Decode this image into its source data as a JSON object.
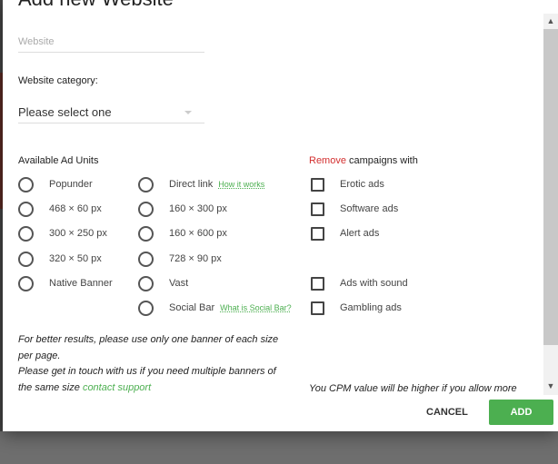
{
  "dialog": {
    "title": "Add new Website",
    "website_placeholder": "Website",
    "category_label": "Website category:",
    "category_value": "Please select one",
    "ad_units_heading": "Available Ad Units",
    "remove_word": "Remove",
    "remove_rest": " campaigns with",
    "ad_units_col1": [
      "Popunder",
      "468 × 60 px",
      "300 × 250 px",
      "320 × 50 px",
      "Native Banner"
    ],
    "ad_units_col2": [
      "Direct link",
      "160 × 300 px",
      "160 × 600 px",
      "728 × 90 px",
      "Vast",
      "Social Bar"
    ],
    "direct_link_help": "How it works",
    "social_bar_help": "What is Social Bar?",
    "exclusions": [
      "Erotic ads",
      "Software ads",
      "Alert ads",
      "Ads with sound",
      "Gambling ads"
    ],
    "note_line1": "For better results, please use only one banner of each size per page.",
    "note_line2": "Please get in touch with us if you need multiple banners of the same size",
    "contact_link": "contact support",
    "cpm_note": "You CPM value will be higher if you allow more",
    "cancel_label": "CANCEL",
    "add_label": "ADD",
    "accent_color": "#4caf50",
    "remove_color": "#d32f2f"
  }
}
